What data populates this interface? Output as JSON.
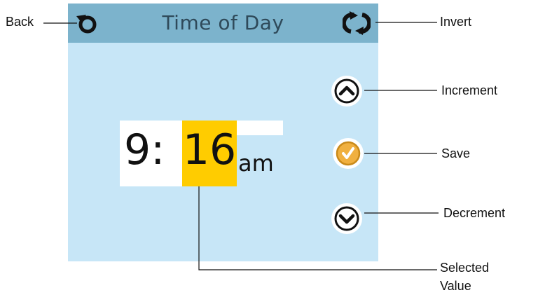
{
  "screen": {
    "title": "Time of Day",
    "time": {
      "hour": "9:",
      "minute": "16",
      "ampm": "am"
    }
  },
  "icons": {
    "back": "back-arrow-icon",
    "invert": "invert-arrows-icon",
    "increment": "chevron-up-icon",
    "save": "checkmark-icon",
    "decrement": "chevron-down-icon"
  },
  "callouts": {
    "back": "Back",
    "invert": "Invert",
    "increment": "Increment",
    "save": "Save",
    "decrement": "Decrement",
    "selected_line1": "Selected",
    "selected_line2": "Value"
  },
  "colors": {
    "title_bar": "#7cb3cc",
    "panel_background": "#c7e6f7",
    "selected_highlight": "#ffcc00",
    "save_button": "#f0b040"
  }
}
